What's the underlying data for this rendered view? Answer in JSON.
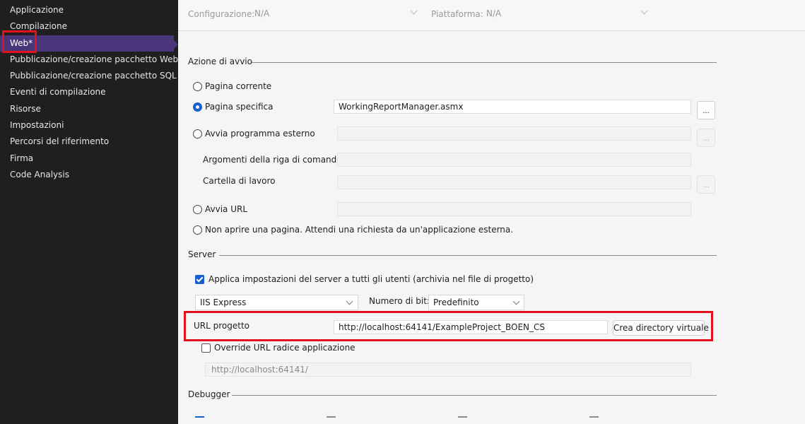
{
  "sidebar": {
    "items": [
      {
        "label": "Applicazione"
      },
      {
        "label": "Compilazione"
      },
      {
        "label": "Web*"
      },
      {
        "label": "Pubblicazione/creazione pacchetto Web"
      },
      {
        "label": "Pubblicazione/creazione pacchetto SQL"
      },
      {
        "label": "Eventi di compilazione"
      },
      {
        "label": "Risorse"
      },
      {
        "label": "Impostazioni"
      },
      {
        "label": "Percorsi del riferimento"
      },
      {
        "label": "Firma"
      },
      {
        "label": "Code Analysis"
      }
    ],
    "selected_color": "#48357a"
  },
  "topbar": {
    "config_label": "Configurazione:",
    "config_value": "N/A",
    "platform_label": "Piattaforma:",
    "platform_value": "N/A"
  },
  "start_action": {
    "heading": "Azione di avvio",
    "current_page": "Pagina corrente",
    "specific_page": "Pagina specifica",
    "specific_page_value": "WorkingReportManager.asmx",
    "browse_label": "...",
    "external_program": "Avvia programma esterno",
    "cmd_args": "Argomenti della riga di comando",
    "working_dir": "Cartella di lavoro",
    "start_url": "Avvia URL",
    "dont_open": "Non aprire una pagina. Attendi una richiesta da un'applicazione esterna."
  },
  "server": {
    "heading": "Server",
    "apply_all_users": "Applica impostazioni del server a tutti gli utenti (archivia nel file di progetto)",
    "server_select": "IIS Express",
    "bitness_label": "Numero di bit:",
    "bitness_value": "Predefinito",
    "project_url_label": "URL progetto",
    "project_url_value": "http://localhost:64141/ExampleProject_BOEN_CS",
    "create_vdir": "Crea directory virtuale",
    "override_root": "Override URL radice applicazione",
    "root_url_value": "http://localhost:64141/"
  },
  "debugger": {
    "heading": "Debugger"
  },
  "colors": {
    "accent": "#1a5ecd",
    "highlight_box": "#e3111b"
  }
}
